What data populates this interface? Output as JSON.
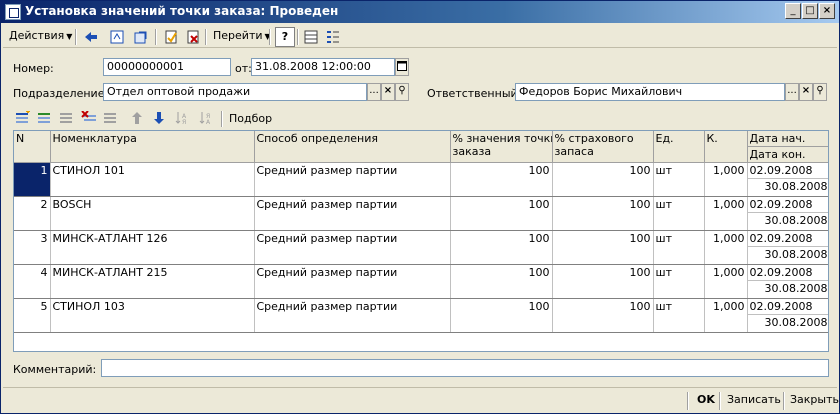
{
  "window": {
    "title": "Установка значений точки заказа: Проведен",
    "min": "_",
    "max": "□",
    "close": "×"
  },
  "toolbar": {
    "actions_label": "Действия",
    "goto_label": "Перейти",
    "help_label": "?"
  },
  "form": {
    "number_label": "Номер:",
    "number_value": "00000000001",
    "from_label": "от:",
    "date_value": "31.08.2008 12:00:00",
    "dept_label": "Подразделение:",
    "dept_value": "Отдел оптовой продажи",
    "resp_label": "Ответственный:",
    "resp_value": "Федоров Борис Михайлович",
    "comment_label": "Комментарий:",
    "comment_value": "",
    "ellipsis": "...",
    "clear": "×",
    "search": "⚲"
  },
  "table_toolbar": {
    "pick_label": "Подбор"
  },
  "table": {
    "headers": {
      "n": "N",
      "nomen": "Номенклатура",
      "method": "Способ определения",
      "pct_order_1": "% значения точки",
      "pct_order_2": "заказа",
      "pct_ins_1": "% страхового",
      "pct_ins_2": "запаса",
      "unit": "Ед.",
      "k": "К.",
      "date_start": "Дата нач.",
      "date_end": "Дата кон."
    },
    "rows": [
      {
        "n": "1",
        "nomen": "СТИНОЛ 101",
        "method": "Средний размер партии",
        "pct_order": "100",
        "pct_ins": "100",
        "unit": "шт",
        "k": "1,000",
        "date_start": "02.09.2008",
        "date_end": "30.08.2008"
      },
      {
        "n": "2",
        "nomen": "BOSCH",
        "method": "Средний размер партии",
        "pct_order": "100",
        "pct_ins": "100",
        "unit": "шт",
        "k": "1,000",
        "date_start": "02.09.2008",
        "date_end": "30.08.2008"
      },
      {
        "n": "3",
        "nomen": "МИНСК-АТЛАНТ 126",
        "method": "Средний размер партии",
        "pct_order": "100",
        "pct_ins": "100",
        "unit": "шт",
        "k": "1,000",
        "date_start": "02.09.2008",
        "date_end": "30.08.2008"
      },
      {
        "n": "4",
        "nomen": "МИНСК-АТЛАНТ 215",
        "method": "Средний размер партии",
        "pct_order": "100",
        "pct_ins": "100",
        "unit": "шт",
        "k": "1,000",
        "date_start": "02.09.2008",
        "date_end": "30.08.2008"
      },
      {
        "n": "5",
        "nomen": "СТИНОЛ 103",
        "method": "Средний размер партии",
        "pct_order": "100",
        "pct_ins": "100",
        "unit": "шт",
        "k": "1,000",
        "date_start": "02.09.2008",
        "date_end": "30.08.2008"
      }
    ]
  },
  "footer": {
    "ok_label": "OK",
    "save_label": "Записать",
    "close_label": "Закрыть"
  },
  "colors": {
    "title_bar": "#0a246a",
    "selection": "#0a246a",
    "window_bg": "#ece9d8"
  }
}
